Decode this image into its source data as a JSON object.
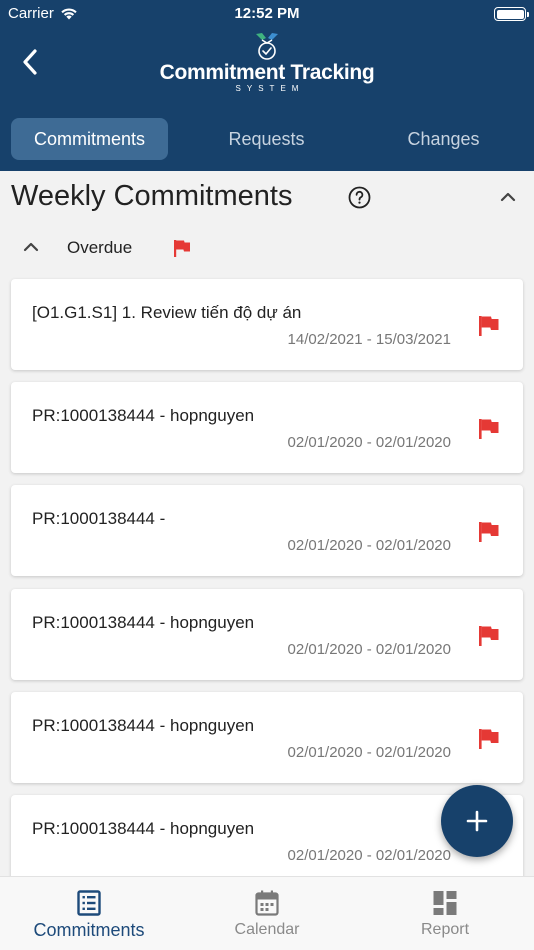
{
  "status_bar": {
    "carrier": "Carrier",
    "time": "12:52 PM"
  },
  "header": {
    "logo_title": "Commitment Tracking",
    "logo_subtitle": "SYSTEM"
  },
  "tabs": [
    {
      "label": "Commitments",
      "active": true
    },
    {
      "label": "Requests",
      "active": false
    },
    {
      "label": "Changes",
      "active": false
    }
  ],
  "section": {
    "title": "Weekly Commitments"
  },
  "group": {
    "label": "Overdue"
  },
  "commitments": [
    {
      "title": "[O1.G1.S1] 1. Review tiến độ dự án",
      "date_range": "14/02/2021 - 15/03/2021"
    },
    {
      "title": "PR:1000138444 - hopnguyen",
      "date_range": "02/01/2020 - 02/01/2020"
    },
    {
      "title": "PR:1000138444 -",
      "date_range": "02/01/2020 - 02/01/2020"
    },
    {
      "title": "PR:1000138444 - hopnguyen",
      "date_range": "02/01/2020 - 02/01/2020"
    },
    {
      "title": "PR:1000138444 - hopnguyen",
      "date_range": "02/01/2020 - 02/01/2020"
    },
    {
      "title": "PR:1000138444 - hopnguyen",
      "date_range": "02/01/2020 - 02/01/2020"
    }
  ],
  "bottom_nav": [
    {
      "label": "Commitments",
      "icon": "list-icon",
      "active": true
    },
    {
      "label": "Calendar",
      "icon": "calendar-icon",
      "active": false
    },
    {
      "label": "Report",
      "icon": "dashboard-icon",
      "active": false
    }
  ],
  "colors": {
    "primary": "#17416b",
    "tab_active": "#3e6b95",
    "flag": "#e53935",
    "nav_active": "#1d4a7a"
  }
}
